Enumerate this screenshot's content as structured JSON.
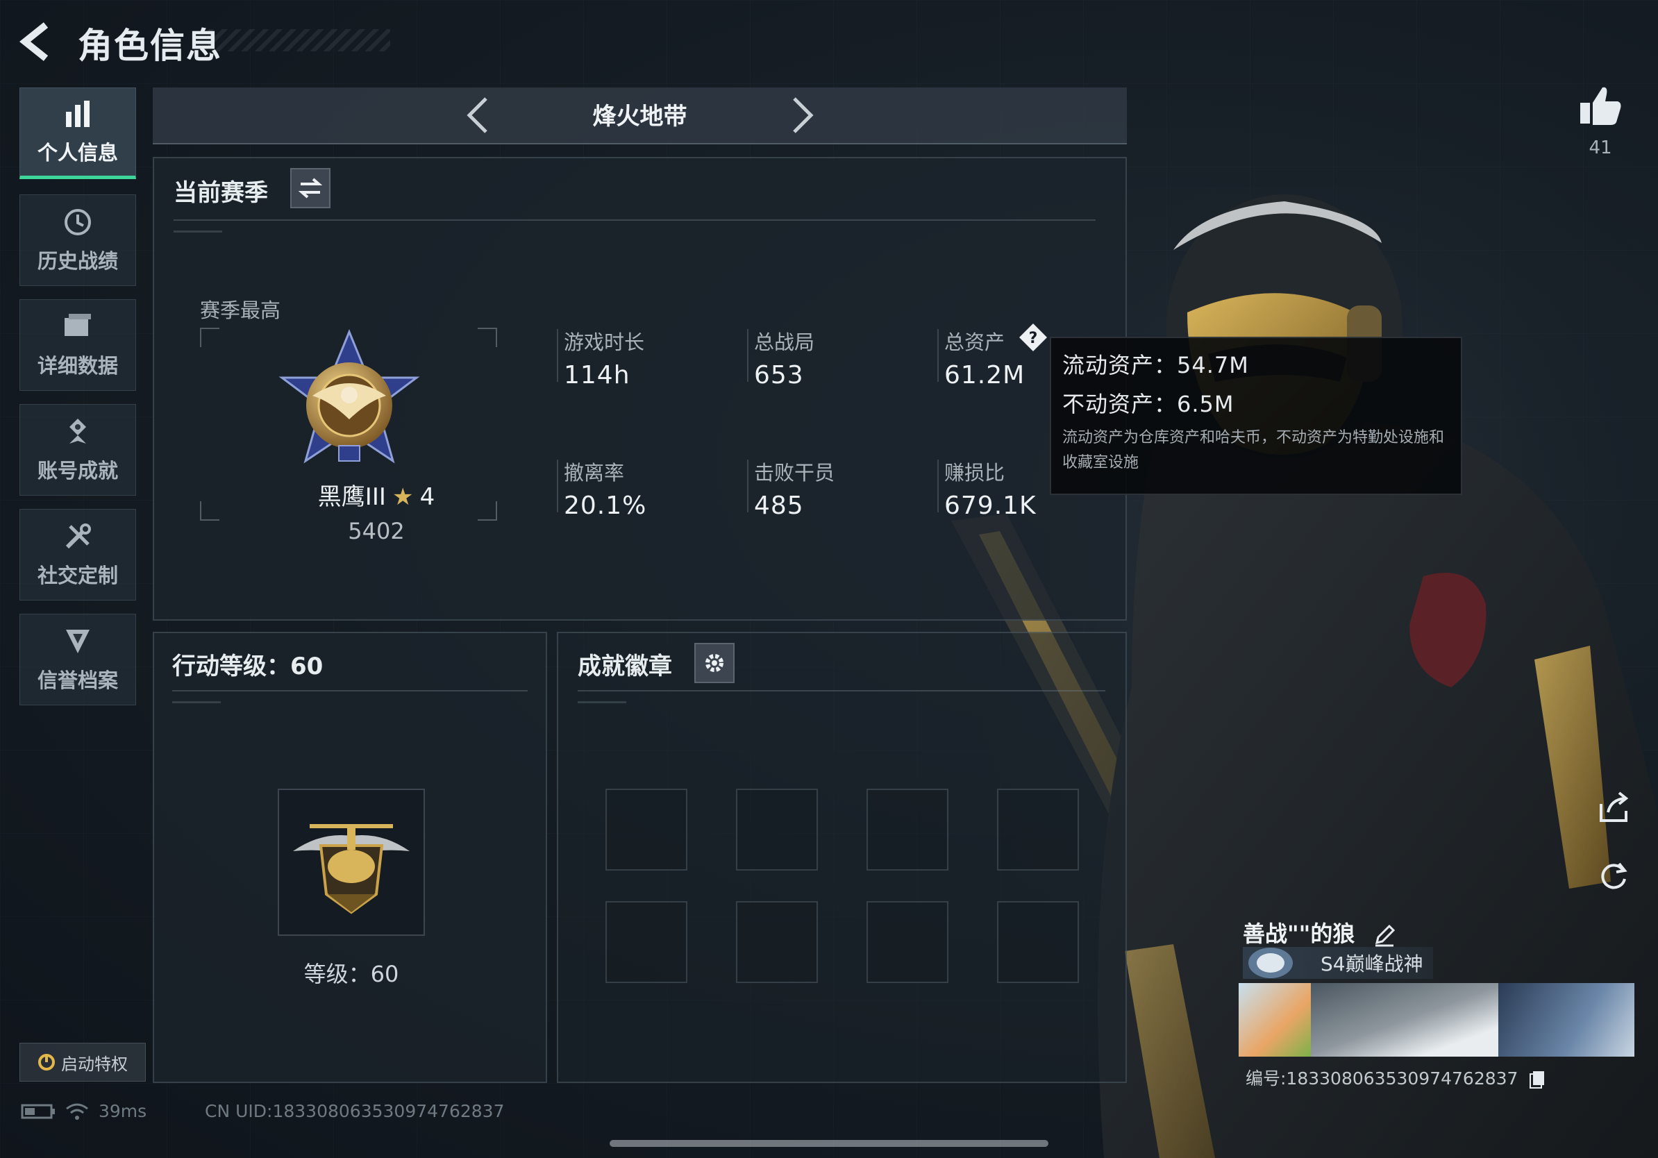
{
  "header": {
    "title": "角色信息"
  },
  "sidebar": {
    "items": [
      {
        "label": "个人信息",
        "icon": "bar-chart-icon",
        "active": true
      },
      {
        "label": "历史战绩",
        "icon": "history-clock-icon"
      },
      {
        "label": "详细数据",
        "icon": "folder-icon"
      },
      {
        "label": "账号成就",
        "icon": "achievement-icon"
      },
      {
        "label": "社交定制",
        "icon": "tools-icon"
      },
      {
        "label": "信誉档案",
        "icon": "shield-icon"
      }
    ],
    "privilege_label": "启动特权"
  },
  "status": {
    "ping": "39ms",
    "uid": "CN UID:1833080635309747628​37"
  },
  "mode_bar": {
    "title": "烽火地带"
  },
  "season": {
    "heading": "当前赛季",
    "best_label": "赛季最高",
    "rank_name": "黑鹰III",
    "rank_stars": "4",
    "rank_score": "5402",
    "stats": [
      {
        "label": "游戏时长",
        "value": "114h"
      },
      {
        "label": "总战局",
        "value": "653"
      },
      {
        "label": "总资产",
        "value": "61.2M"
      },
      {
        "label": "撤离率",
        "value": "20.1%"
      },
      {
        "label": "击败干员",
        "value": "485"
      },
      {
        "label": "赚损比",
        "value": "679.1K"
      }
    ]
  },
  "tooltip": {
    "liquid": "流动资产：54.7M",
    "fixed": "不动资产：6.5M",
    "note": "流动资产为仓库资产和哈夫币，不动资产为特勤处设施和收藏室设施"
  },
  "action_level": {
    "heading": "行动等级：60",
    "level_text": "等级：60"
  },
  "badges": {
    "heading": "成就徽章"
  },
  "likes": {
    "count": "41"
  },
  "player": {
    "name": "善战\"\"的狼",
    "title": "S4巅峰战神",
    "card_id": "编号:183308063530974762837"
  },
  "colors": {
    "accent": "#3ed59a",
    "background": "#141b22",
    "gold": "#c9a24a"
  }
}
